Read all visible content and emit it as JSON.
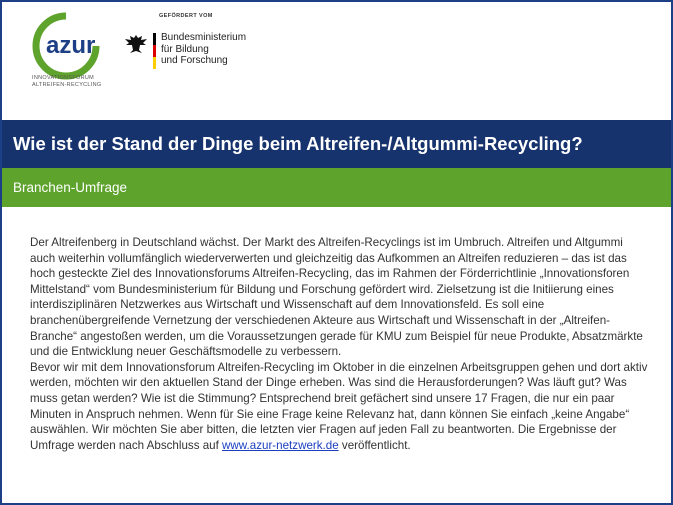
{
  "logo": {
    "name": "azur",
    "subtitle_line1": "INNOVATIONSFORUM",
    "subtitle_line2": "ALTREIFEN-RECYCLING",
    "ring_color": "#5ea32c",
    "text_color": "#1d3f86"
  },
  "sponsor": {
    "label": "GEFÖRDERT VOM",
    "ministry_line1": "Bundesministerium",
    "ministry_line2": "für Bildung",
    "ministry_line3": "und Forschung"
  },
  "title": "Wie ist der Stand der Dinge beim Altreifen-/Altgummi-Recycling?",
  "subtitle": "Branchen-Umfrage",
  "body": {
    "paragraph1": "Der Altreifenberg in Deutschland wächst. Der Markt des Altreifen-Recyclings ist im Umbruch. Altreifen und Altgummi auch weiterhin vollumfänglich wiederverwerten und gleichzeitig das Aufkommen an Altreifen reduzieren – das ist das hoch gesteckte Ziel des Innovationsforums Altreifen-Recycling, das im Rahmen der Förderrichtlinie „Innovationsforen Mittelstand“ vom Bundesministerium für Bildung und Forschung gefördert wird. Zielsetzung ist die Initiierung eines interdisziplinären Netzwerkes aus Wirtschaft und Wissenschaft auf dem Innovationsfeld. Es soll eine branchenübergreifende Vernetzung der verschiedenen Akteure aus Wirtschaft und Wissenschaft in der „Altreifen-Branche“ angestoßen werden, um die Voraussetzungen gerade für KMU zum Beispiel für neue Produkte, Absatzmärkte und die Entwicklung neuer Geschäftsmodelle zu verbessern.",
    "paragraph2": "Bevor wir mit dem Innovationsforum Altreifen-Recycling im Oktober in die einzelnen Arbeitsgruppen gehen und dort aktiv werden, möchten wir den aktuellen Stand der Dinge erheben. Was sind die Herausforderungen? Was läuft gut? Was muss getan werden? Wie ist die Stimmung? Entsprechend breit gefächert sind unsere 17 Fragen, die nur ein paar Minuten in Anspruch nehmen. Wenn für Sie eine Frage keine Relevanz hat, dann können Sie einfach „keine Angabe“ auswählen. Wir möchten Sie aber bitten, die letzten vier Fragen auf jeden Fall zu beantworten. Die Ergebnisse der Umfrage werden nach Abschluss auf ",
    "link_text": "www.azur-netzwerk.de",
    "paragraph2_end": " veröffentlicht."
  },
  "colors": {
    "title_bar": "#17336e",
    "subtitle_bar": "#5ea32c",
    "frame_border": "#1d3f86",
    "link": "#1a3fc0"
  }
}
